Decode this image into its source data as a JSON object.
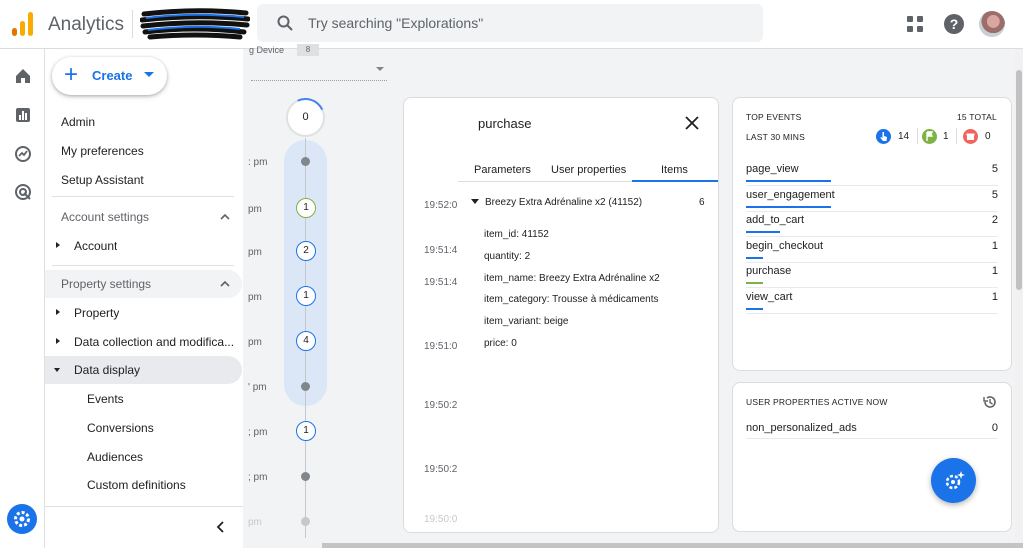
{
  "app": {
    "title": "Analytics",
    "search_placeholder": "Try searching \"Explorations\""
  },
  "colors": {
    "accent": "#1a73e8",
    "logo_orange": "#f9ab00",
    "logo_dark_orange": "#e37400",
    "green": "#7cb342",
    "red": "#ee675c"
  },
  "icons": {
    "rail": [
      "home-icon",
      "reports-icon",
      "explore-icon",
      "advertising-icon"
    ],
    "topbar": [
      "search-icon",
      "apps-grid-icon",
      "help-icon"
    ]
  },
  "create": {
    "label": "Create"
  },
  "menu": {
    "admin": "Admin",
    "my_preferences": "My preferences",
    "setup_assistant": "Setup Assistant",
    "account_settings": "Account settings",
    "account": "Account",
    "property_settings": "Property settings",
    "property": "Property",
    "data_collection": "Data collection and modifica...",
    "data_display": "Data display",
    "events": "Events",
    "conversions": "Conversions",
    "audiences": "Audiences",
    "custom_definitions": "Custom definitions"
  },
  "timeline": {
    "device_label": "g Device",
    "device_count": "8",
    "top_count": "0",
    "nodes": [
      {
        "type": "dot",
        "time": ": pm"
      },
      {
        "type": "num",
        "value": "1",
        "green": true,
        "time": "pm"
      },
      {
        "type": "num",
        "value": "2",
        "time": "pm"
      },
      {
        "type": "num",
        "value": "1",
        "time": "pm"
      },
      {
        "type": "num",
        "value": "4",
        "time": "pm"
      },
      {
        "type": "dot",
        "time": "' pm"
      },
      {
        "type": "num",
        "value": "1",
        "time": "; pm"
      },
      {
        "type": "dot",
        "time": "; pm"
      },
      {
        "type": "dot",
        "time": "pm"
      }
    ]
  },
  "event_detail": {
    "title": "purchase",
    "tabs": [
      "Parameters",
      "User properties",
      "Items"
    ],
    "active_tab": "Items",
    "times": [
      "19:52:0",
      "19:51:4",
      "19:51:4",
      "19:51:0",
      "19:50:2",
      "19:50:2",
      "19:50:0"
    ],
    "item_header": "Breezy Extra Adrénaline x2 (41152)",
    "item_count": "6",
    "item_props": [
      "item_id: 41152",
      "quantity: 2",
      "item_name: Breezy Extra Adrénaline x2",
      "item_category: Trousse à médicaments",
      "item_variant: beige",
      "price: 0"
    ]
  },
  "top_events": {
    "heading": "TOP EVENTS",
    "total": "15 TOTAL",
    "period": "LAST 30 MINS",
    "badges": [
      {
        "icon": "touch-icon",
        "color": "#1a73e8",
        "count": "14"
      },
      {
        "icon": "flag-icon",
        "color": "#7cb342",
        "count": "1"
      },
      {
        "icon": "gift-icon",
        "color": "#ee675c",
        "count": "0"
      }
    ],
    "rows": [
      {
        "name": "page_view",
        "count": "5",
        "fraction": 1.0
      },
      {
        "name": "user_engagement",
        "count": "5",
        "fraction": 1.0
      },
      {
        "name": "add_to_cart",
        "count": "2",
        "fraction": 0.4
      },
      {
        "name": "begin_checkout",
        "count": "1",
        "fraction": 0.2
      },
      {
        "name": "purchase",
        "count": "1",
        "fraction": 0.2,
        "color": "#7cb342"
      },
      {
        "name": "view_cart",
        "count": "1",
        "fraction": 0.2
      }
    ]
  },
  "user_properties": {
    "heading": "USER PROPERTIES ACTIVE NOW",
    "rows": [
      {
        "name": "non_personalized_ads",
        "count": "0"
      }
    ]
  }
}
